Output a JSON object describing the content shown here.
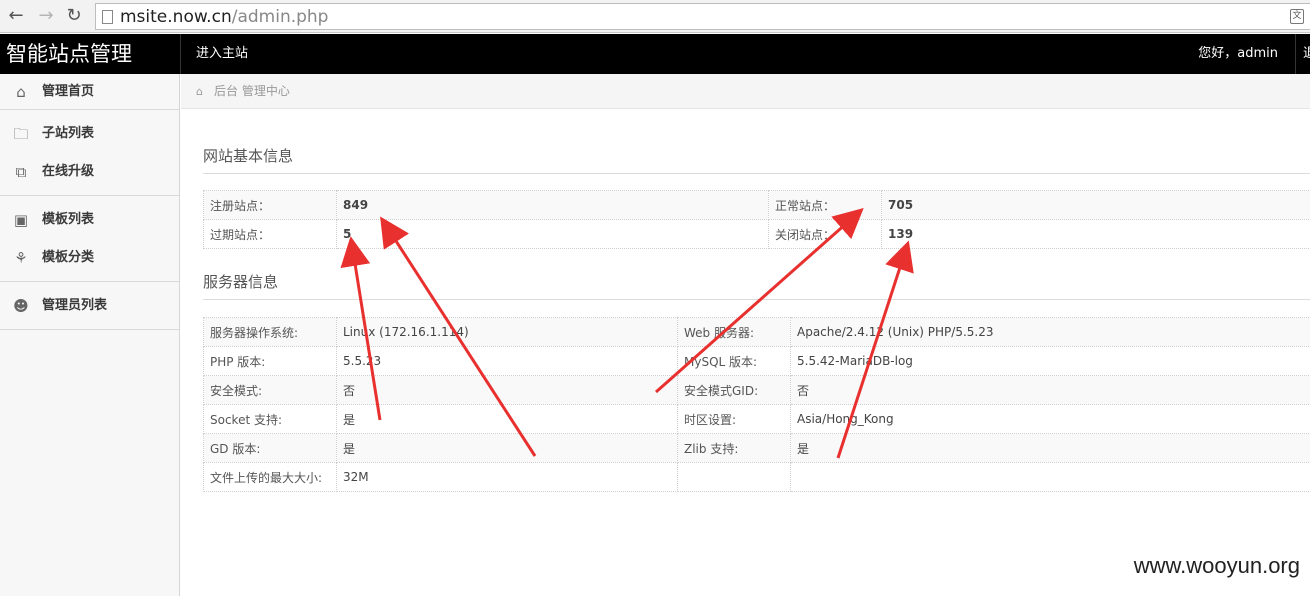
{
  "browser": {
    "back_icon": "arrow-left-icon",
    "forward_icon": "arrow-right-icon",
    "reload_icon": "reload-icon",
    "url_host": "msite.now.cn",
    "url_path": "/admin.php"
  },
  "topbar": {
    "brand": "智能站点管理",
    "home_link": "进入主站",
    "greeting": "您好，admin",
    "more_link": "退出"
  },
  "sidebar": {
    "items": [
      {
        "label": "管理首页",
        "icon": "home-icon"
      },
      {
        "label": "子站列表",
        "icon": "folder-icon"
      },
      {
        "label": "在线升级",
        "icon": "copy-icon"
      },
      {
        "label": "模板列表",
        "icon": "presentation-icon"
      },
      {
        "label": "模板分类",
        "icon": "sitemap-icon"
      },
      {
        "label": "管理员列表",
        "icon": "user-icon"
      }
    ]
  },
  "breadcrumb": {
    "icon": "home-icon",
    "text": "后台 管理中心"
  },
  "site_info": {
    "title": "网站基本信息",
    "rows": [
      {
        "k1": "注册站点：",
        "v1": "849",
        "k2": "正常站点：",
        "v2": "705"
      },
      {
        "k1": "过期站点：",
        "v1": "5",
        "k2": "关闭站点：",
        "v2": "139"
      }
    ]
  },
  "server_info": {
    "title": "服务器信息",
    "rows": [
      {
        "k1": "服务器操作系统:",
        "v1": "Linux (172.16.1.114)",
        "k2": "Web 服务器:",
        "v2": "Apache/2.4.12 (Unix) PHP/5.5.23"
      },
      {
        "k1": "PHP 版本:",
        "v1": "5.5.23",
        "k2": "MySQL 版本:",
        "v2": "5.5.42-MariaDB-log"
      },
      {
        "k1": "安全模式:",
        "v1": "否",
        "k2": "安全模式GID:",
        "v2": "否"
      },
      {
        "k1": "Socket 支持:",
        "v1": "是",
        "k2": "时区设置:",
        "v2": "Asia/Hong_Kong"
      },
      {
        "k1": "GD 版本:",
        "v1": "是",
        "k2": "Zlib 支持:",
        "v2": "是"
      },
      {
        "k1": "文件上传的最大大小:",
        "v1": "32M",
        "k2": "",
        "v2": ""
      }
    ]
  },
  "watermark": "www.wooyun.org",
  "colors": {
    "topbar": "#000000",
    "arrow": "#e8302f"
  }
}
